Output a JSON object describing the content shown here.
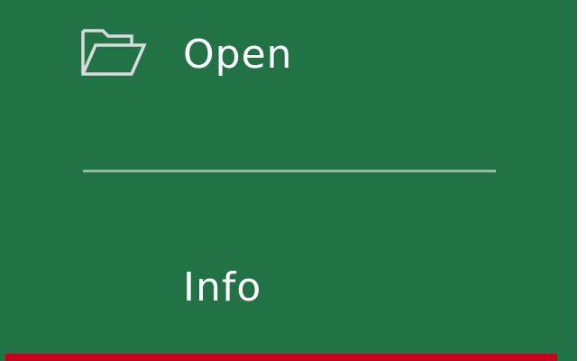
{
  "backstage_menu": {
    "open": {
      "label": "Open",
      "icon": "folder-open-icon"
    },
    "info": {
      "label": "Info"
    }
  },
  "colors": {
    "background": "#217346",
    "text": "#ffffff",
    "divider": "#8fbfa3",
    "highlight": "#c8001e"
  }
}
